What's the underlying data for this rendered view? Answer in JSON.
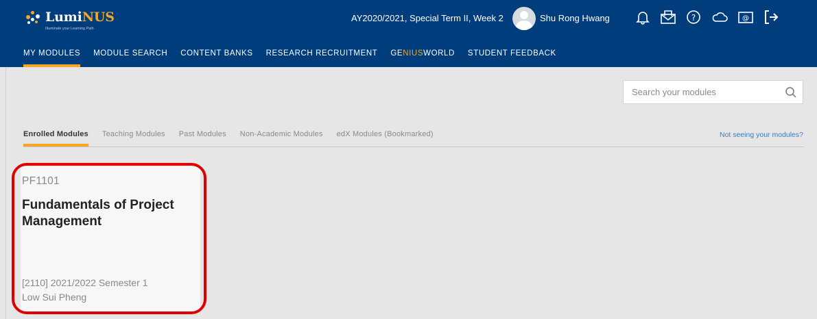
{
  "header": {
    "logo": {
      "brand_prefix": "Lumi",
      "brand_suffix": "NUS",
      "tagline": "Illuminate your Learning Path"
    },
    "term": "AY2020/2021, Special Term II, Week 2",
    "user": {
      "name": "Shu Rong Hwang"
    },
    "icons": [
      "bell-icon",
      "mail-icon",
      "help-icon",
      "cloud-icon",
      "email-at-icon",
      "logout-icon"
    ],
    "nav": {
      "my_modules": "MY MODULES",
      "module_search": "MODULE SEARCH",
      "content_banks": "CONTENT BANKS",
      "research_recruitment": "RESEARCH RECRUITMENT",
      "genius_prefix": "GE",
      "genius_mid": "NIUS",
      "genius_suffix": "WORLD",
      "student_feedback": "STUDENT FEEDBACK"
    }
  },
  "search": {
    "placeholder": "Search your modules"
  },
  "tabs": {
    "enrolled": "Enrolled Modules",
    "teaching": "Teaching Modules",
    "past": "Past Modules",
    "non_academic": "Non-Academic Modules",
    "edx": "edX Modules (Bookmarked)"
  },
  "not_seeing": "Not seeing your modules?",
  "modules": [
    {
      "code": "PF1101",
      "title": "Fundamentals of Project Management",
      "term": "[2110] 2021/2022 Semester 1",
      "lecturer": "Low Sui Pheng"
    }
  ],
  "colors": {
    "header_bg": "#003d7c",
    "accent": "#f5a623",
    "highlight": "#e00000",
    "link": "#3b7bbf"
  }
}
